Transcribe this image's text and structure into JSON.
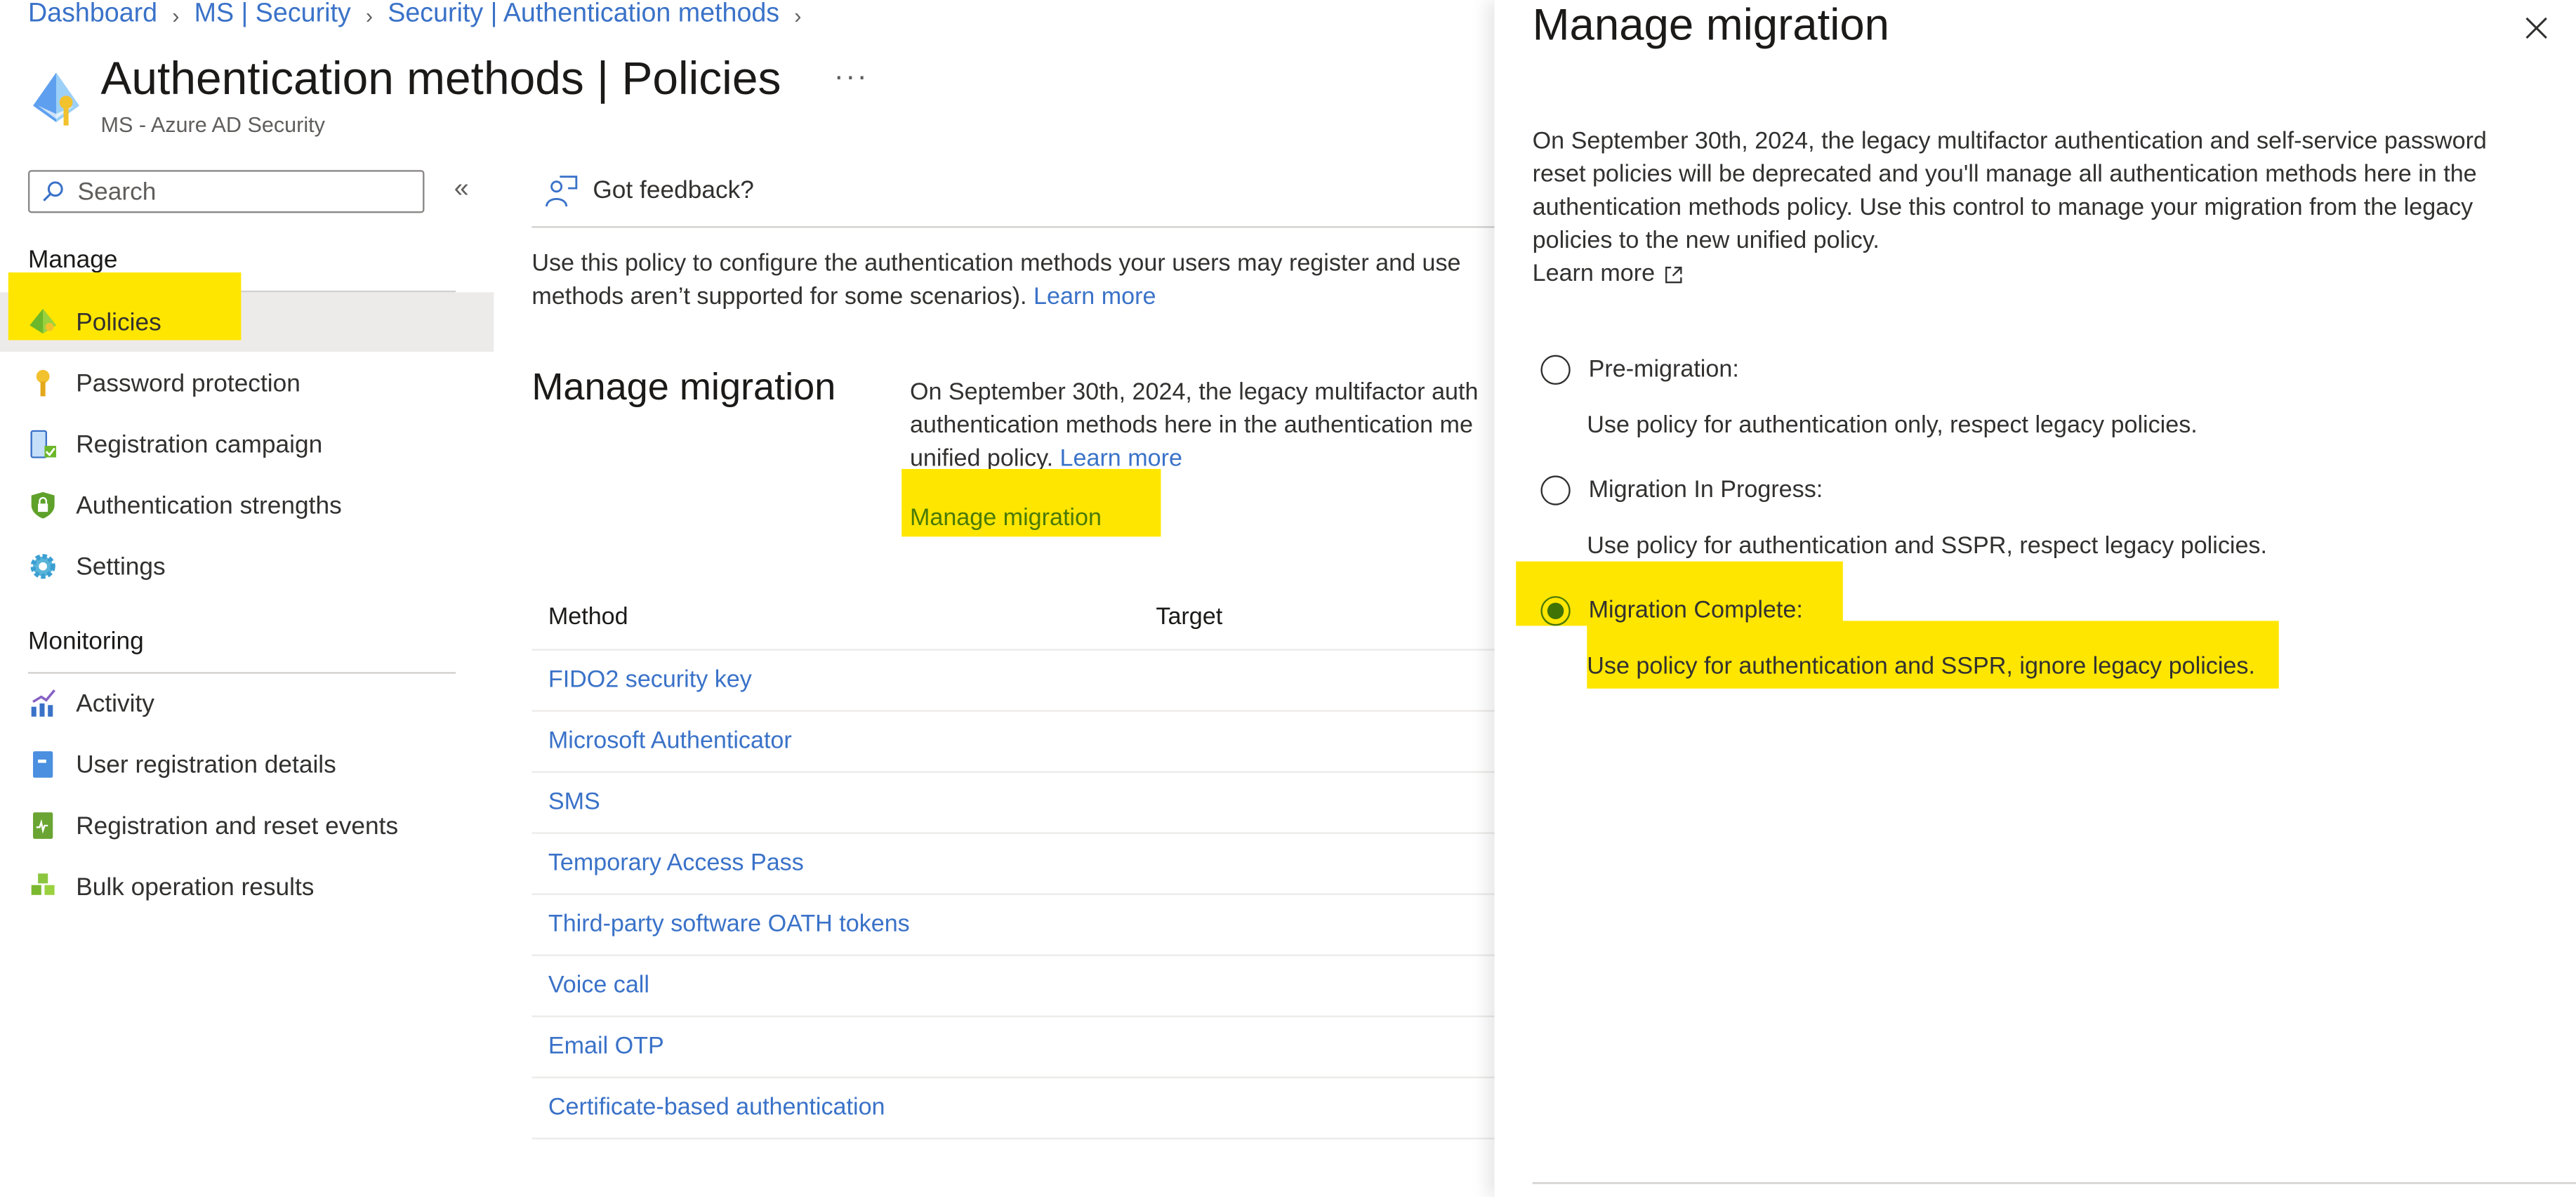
{
  "breadcrumb": [
    "Dashboard",
    "MS | Security",
    "Security | Authentication methods"
  ],
  "header": {
    "title": "Authentication methods | Policies",
    "subtitle": "MS - Azure AD Security",
    "more": "···"
  },
  "sidebar": {
    "search_placeholder": "Search",
    "collapse": "«",
    "sections": [
      {
        "title": "Manage",
        "items": [
          {
            "label": "Policies",
            "icon": "policies-icon",
            "active": true
          },
          {
            "label": "Password protection",
            "icon": "key-icon"
          },
          {
            "label": "Registration campaign",
            "icon": "phone-check-icon"
          },
          {
            "label": "Authentication strengths",
            "icon": "shield-lock-icon"
          },
          {
            "label": "Settings",
            "icon": "gear-icon"
          }
        ]
      },
      {
        "title": "Monitoring",
        "items": [
          {
            "label": "Activity",
            "icon": "activity-chart-icon"
          },
          {
            "label": "User registration details",
            "icon": "book-icon"
          },
          {
            "label": "Registration and reset events",
            "icon": "events-book-icon"
          },
          {
            "label": "Bulk operation results",
            "icon": "cubes-icon"
          }
        ]
      }
    ]
  },
  "main": {
    "feedback": "Got feedback?",
    "description_line1": "Use this policy to configure the authentication methods your users may register and use",
    "description_line2": "methods aren’t supported for some scenarios).",
    "learn_more": "Learn more",
    "manage_migration": {
      "heading": "Manage migration",
      "text_line1": "On September 30th, 2024, the legacy multifactor auth",
      "text_line2": "authentication methods here in the authentication me",
      "text_line3": "unified policy.",
      "learn_more": "Learn more",
      "link": "Manage migration"
    },
    "table": {
      "columns": [
        "Method",
        "Target"
      ],
      "rows": [
        "FIDO2 security key",
        "Microsoft Authenticator",
        "SMS",
        "Temporary Access Pass",
        "Third-party software OATH tokens",
        "Voice call",
        "Email OTP",
        "Certificate-based authentication"
      ]
    }
  },
  "panel": {
    "title": "Manage migration",
    "description": "On September 30th, 2024, the legacy multifactor authentication and self-service password reset policies will be deprecated and you'll manage all authentication methods here in the authentication methods policy. Use this control to manage your migration from the legacy policies to the new unified policy.",
    "learn_more": "Learn more",
    "options": [
      {
        "label": "Pre-migration:",
        "description": "Use policy for authentication only, respect legacy policies.",
        "selected": false
      },
      {
        "label": "Migration In Progress:",
        "description": "Use policy for authentication and SSPR, respect legacy policies.",
        "selected": false
      },
      {
        "label": "Migration Complete:",
        "description": "Use policy for authentication and SSPR, ignore legacy policies.",
        "selected": true
      }
    ]
  },
  "colors": {
    "link": "#3a72c8",
    "highlight": "#ffe600",
    "selected_radio": "#3f7305"
  }
}
